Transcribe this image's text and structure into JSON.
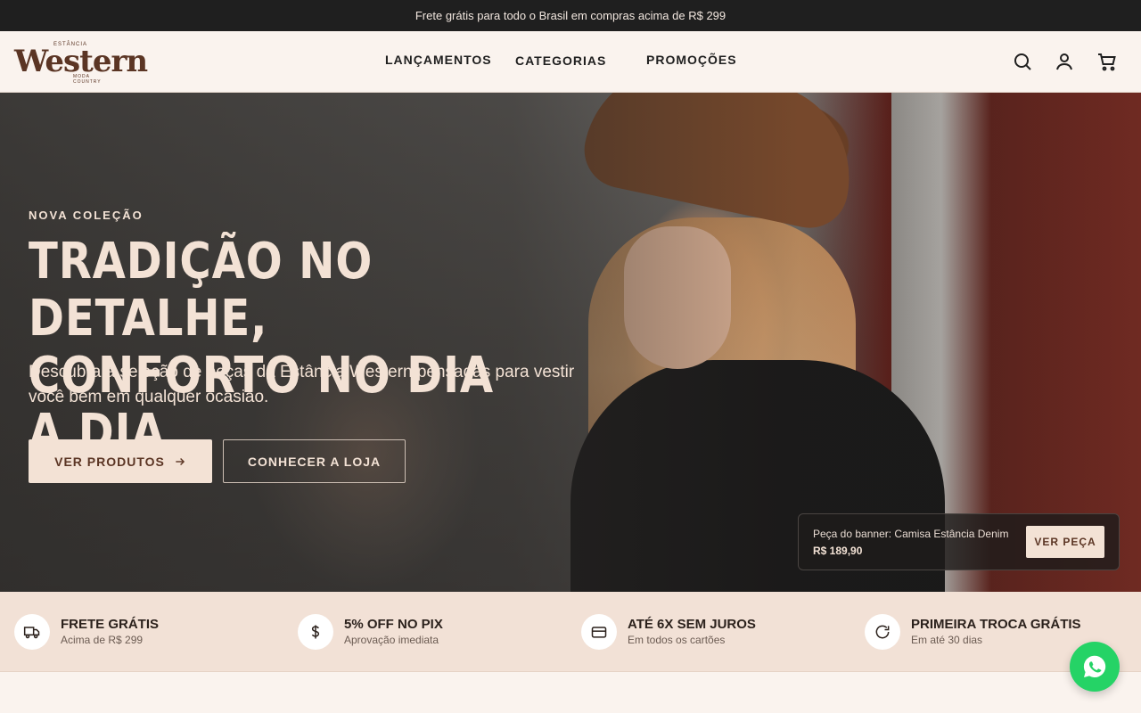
{
  "topbar": {
    "text": "Frete grátis para todo o Brasil em compras acima de R$ 299"
  },
  "logo": {
    "top": "ESTÂNCIA",
    "word": "Western",
    "bottom": "MODA COUNTRY"
  },
  "nav": {
    "items": [
      {
        "label": "LANÇAMENTOS"
      },
      {
        "label": "CATEGORIAS"
      },
      {
        "label": "PROMOÇÕES"
      }
    ]
  },
  "header_icons": [
    "search-icon",
    "user-icon",
    "cart-icon"
  ],
  "hero": {
    "eyebrow": "NOVA COLEÇÃO",
    "title_line1": "TRADIÇÃO NO DETALHE,",
    "title_line2": "CONFORTO NO DIA A DIA.",
    "subtitle": "Descubra a seleção de peças da Estância Western pensadas para vestir você bem em qualquer ocasião.",
    "primary_button": "VER PRODUTOS",
    "secondary_button": "CONHECER A LOJA"
  },
  "banner_card": {
    "label": "Peça do banner: Camisa Estância Denim",
    "price": "R$ 189,90",
    "button": "VER PEÇA"
  },
  "benefits": [
    {
      "icon": "truck-icon",
      "title": "FRETE GRÁTIS",
      "subtitle": "Acima de R$ 299"
    },
    {
      "icon": "dollar-icon",
      "title": "5% OFF NO PIX",
      "subtitle": "Aprovação imediata"
    },
    {
      "icon": "credit-card-icon",
      "title": "ATÉ 6X SEM JUROS",
      "subtitle": "Em todos os cartões"
    },
    {
      "icon": "refresh-icon",
      "title": "PRIMEIRA TROCA GRÁTIS",
      "subtitle": "Em até 30 dias"
    }
  ],
  "colors": {
    "topbar_bg": "#1f1f1f",
    "header_bg": "#faf3ee",
    "brand_brown": "#5b3524",
    "cream": "#f3e2d5",
    "benefits_bg": "#f2e1d6",
    "whatsapp_green": "#25d366"
  }
}
